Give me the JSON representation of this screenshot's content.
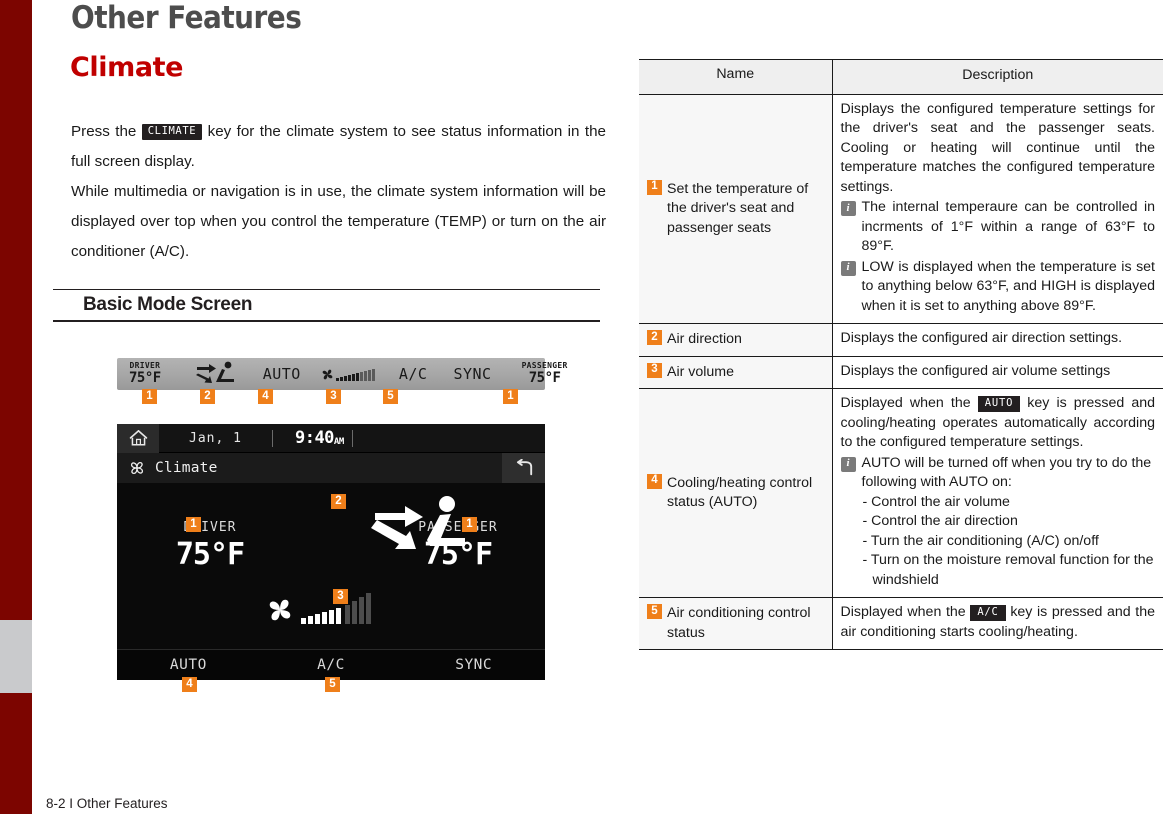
{
  "page": {
    "title": "Other Features",
    "subtitle": "Climate",
    "footer": "8-2 I Other Features",
    "accent_orange": "#ef7f1a",
    "accent_red": "#c00000",
    "edge_red": "#7c0500",
    "edge_gray": "#c9cacc"
  },
  "intro": {
    "part1": "Press the",
    "keycap": "CLIMATE",
    "part2": "key for the climate system to see status information in the full screen display.",
    "part3": "While multimedia or navigation is in use, the climate system information will be displayed over top when you control the temperature (TEMP) or turn on the air conditioner (A/C)."
  },
  "section": {
    "title": "Basic Mode Screen"
  },
  "strip": {
    "driver_label": "DRIVER",
    "driver_value": "75°F",
    "auto": "AUTO",
    "ac": "A/C",
    "sync": "SYNC",
    "passenger_label": "PASSENGER",
    "passenger_value": "75°F",
    "markers": [
      "1",
      "2",
      "4",
      "3",
      "5",
      "1"
    ]
  },
  "screen": {
    "date": "Jan,  1",
    "time": "9:40",
    "time_suffix": "AM",
    "title": "Climate",
    "driver_label": "DRIVER",
    "driver_value": "75°F",
    "passenger_label": "PASSENGER",
    "passenger_value": "75°F",
    "footer_items": [
      "AUTO",
      "A/C",
      "SYNC"
    ],
    "markers": {
      "driver": "1",
      "passenger": "1",
      "seat": "2",
      "fan": "3",
      "auto": "4",
      "ac": "5"
    }
  },
  "table": {
    "headers": {
      "name": "Name",
      "description": "Description"
    },
    "rows": [
      {
        "num": "1",
        "name": "Set the temperature of the driver's seat and passenger seats",
        "desc_main": "Displays the configured temperature settings for the driver's seat and the passenger seats. Cooling or heating will continue until the temperature matches the configured temperature settings.",
        "info": [
          "The internal temperaure can be controlled in incrments of 1°F within a range of 63°F to 89°F.",
          "LOW is displayed when the temperature is set to anything below 63°F, and HIGH is displayed when it is set to anything above 89°F."
        ]
      },
      {
        "num": "2",
        "name": "Air direction",
        "desc_main": "Displays the configured air direction settings.",
        "info": []
      },
      {
        "num": "3",
        "name": "Air volume",
        "desc_main": "Displays the configured air volume settings",
        "info": []
      },
      {
        "num": "4",
        "name": "Cooling/heating control status (AUTO)",
        "desc_pre": "Displayed when the",
        "keycap": "AUTO",
        "desc_post": "key is pressed and cooling/heating operates automatically according to the configured temperature settings.",
        "info": [
          "AUTO will be turned off when you try to do the following with AUTO on:"
        ],
        "bullets": [
          "- Control the air volume",
          "- Control the air direction",
          "- Turn the air conditioning (A/C) on/off",
          "- Turn on the moisture removal function for the windshield"
        ]
      },
      {
        "num": "5",
        "name": "Air conditioning control status",
        "desc_pre": "Displayed when the",
        "keycap": "A/C",
        "desc_post": "key is pressed and the air conditioning starts cooling/heating.",
        "info": []
      }
    ]
  },
  "icons": {
    "home": "home-icon",
    "back": "back-arrow-icon",
    "fan": "fan-icon",
    "seat": "seat-airflow-icon",
    "info": "info-icon"
  }
}
